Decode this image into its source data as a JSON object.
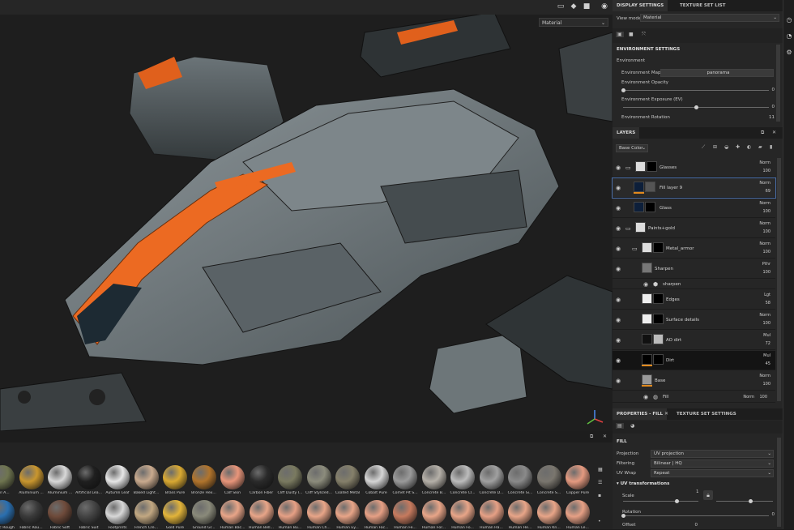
{
  "viewport": {
    "mode": "Material",
    "toolbar_icons": [
      "camera-frame-icon",
      "cube-icon",
      "video-icon",
      "screenshot-icon"
    ]
  },
  "top_tabs": {
    "display_settings": "DISPLAY SETTINGS",
    "texture_set_list": "TEXTURE SET LIST"
  },
  "view_mode": {
    "label": "View mode",
    "value": "Material"
  },
  "environment": {
    "section_title": "ENVIRONMENT SETTINGS",
    "group": "Environment",
    "map_label": "Environment Map",
    "map_value": "panorama",
    "opacity_label": "Environment Opacity",
    "opacity_value": "0",
    "opacity_fraction": 0.0,
    "exposure_label": "Environment Exposure (EV)",
    "exposure_value": "0",
    "exposure_fraction": 0.5,
    "rotation_label": "Environment Rotation",
    "rotation_value": "11"
  },
  "layers": {
    "title": "LAYERS",
    "channel": "Base Color",
    "rows": [
      {
        "name": "Glasses",
        "blend": "Norm",
        "opacity": "100",
        "kind": "folder"
      },
      {
        "name": "Fill layer 9",
        "blend": "Norm",
        "opacity": "69",
        "kind": "fill"
      },
      {
        "name": "Glass",
        "blend": "Norm",
        "opacity": "100",
        "kind": "layer"
      },
      {
        "name": "Paints+gold",
        "blend": "Norm",
        "opacity": "100",
        "kind": "folder"
      },
      {
        "name": "Metal_armor",
        "blend": "Norm",
        "opacity": "100",
        "kind": "folder"
      },
      {
        "name": "Sharpen",
        "blend": "Pthr",
        "opacity": "100",
        "kind": "filter"
      },
      {
        "name": "sharpen",
        "blend": "",
        "opacity": "",
        "kind": "sub"
      },
      {
        "name": "Edges",
        "blend": "Lgt",
        "opacity": "58",
        "kind": "layer"
      },
      {
        "name": "Surface details",
        "blend": "Norm",
        "opacity": "100",
        "kind": "layer"
      },
      {
        "name": "AO dirt",
        "blend": "Mul",
        "opacity": "72",
        "kind": "layer"
      },
      {
        "name": "Dirt",
        "blend": "Mul",
        "opacity": "45",
        "kind": "layer"
      },
      {
        "name": "Base",
        "blend": "Norm",
        "opacity": "100",
        "kind": "layer"
      },
      {
        "name": "Fill",
        "blend": "Norm",
        "opacity": "100",
        "kind": "sub"
      }
    ]
  },
  "properties": {
    "tab_fill": "PROPERTIES - FILL",
    "tab_texture_set": "TEXTURE SET SETTINGS",
    "section": "FILL",
    "projection_label": "Projection",
    "projection_value": "UV projection",
    "filtering_label": "Filtering",
    "filtering_value": "Bilinear | HQ",
    "uvwrap_label": "UV Wrap",
    "uvwrap_value": "Repeat",
    "uv_transform_title": "UV transformations",
    "scale_label": "Scale",
    "scale_value": "1",
    "rotation_label": "Rotation",
    "rotation_value": "0",
    "offset_label": "Offset",
    "offset_value": "0"
  },
  "shelf": {
    "row1": [
      {
        "label": "Soil A...",
        "color": "#6f7550"
      },
      {
        "label": "Aluminium ...",
        "color": "#c9962e"
      },
      {
        "label": "Aluminium ...",
        "color": "#d8d8d8"
      },
      {
        "label": "Artificial Lea...",
        "color": "#1f1f1f"
      },
      {
        "label": "Autumn Leaf",
        "color": "#e7e7e7"
      },
      {
        "label": "Baked Light...",
        "color": "#c9aa8e"
      },
      {
        "label": "Brass Pure",
        "color": "#d9a932"
      },
      {
        "label": "Bronze Hex...",
        "color": "#b1742c"
      },
      {
        "label": "Calf Skin",
        "color": "#e8957a"
      },
      {
        "label": "Carbon Fiber",
        "color": "#2a2a2a"
      },
      {
        "label": "Cliff Dusty I...",
        "color": "#7a7a60"
      },
      {
        "label": "Cliff Stylized...",
        "color": "#8c8c7c"
      },
      {
        "label": "Coated Metal",
        "color": "#85806a"
      },
      {
        "label": "Cobalt Pure",
        "color": "#d5d5d5"
      },
      {
        "label": "Comet Pit S...",
        "color": "#9a9a9a"
      },
      {
        "label": "Concrete B...",
        "color": "#b5b0a8"
      },
      {
        "label": "Concrete Cl...",
        "color": "#bcbcbc"
      },
      {
        "label": "Concrete D...",
        "color": "#a0a0a0"
      },
      {
        "label": "Concrete Si...",
        "color": "#8a8a8a"
      },
      {
        "label": "Concrete S...",
        "color": "#7a766e"
      },
      {
        "label": "Copper Pure",
        "color": "#e59a80"
      }
    ],
    "row2": [
      {
        "label": "Fabric Rough",
        "color": "#2a6fb0"
      },
      {
        "label": "Fabric Rou...",
        "color": "#3a3a3a"
      },
      {
        "label": "Fabric Soft",
        "color": "#6e4a3a"
      },
      {
        "label": "Fabric Suit",
        "color": "#444444"
      },
      {
        "label": "Footprints",
        "color": "#d8d8d8"
      },
      {
        "label": "French Cre...",
        "color": "#c2a882"
      },
      {
        "label": "Gold Pure",
        "color": "#e2b43a"
      },
      {
        "label": "Ground Gr...",
        "color": "#8a8a7a"
      },
      {
        "label": "Human Bac...",
        "color": "#e8a588"
      },
      {
        "label": "Human Bell...",
        "color": "#e8a588"
      },
      {
        "label": "Human Bu...",
        "color": "#e6a085"
      },
      {
        "label": "Human Ch...",
        "color": "#e8a588"
      },
      {
        "label": "Human Ey...",
        "color": "#e8a588"
      },
      {
        "label": "Human Fac...",
        "color": "#e6a085"
      },
      {
        "label": "Human Fe...",
        "color": "#c67a5e"
      },
      {
        "label": "Human For...",
        "color": "#e8a588"
      },
      {
        "label": "Human Fo...",
        "color": "#e8a588"
      },
      {
        "label": "Human Ha...",
        "color": "#e6a085"
      },
      {
        "label": "Human He...",
        "color": "#e8a588"
      },
      {
        "label": "Human Kn...",
        "color": "#e8a588"
      },
      {
        "label": "Human Le...",
        "color": "#e6a085"
      }
    ]
  },
  "colors": {
    "accent_orange": "#e28a1e",
    "selection_blue": "#4a6ea8",
    "panel_bg": "#262626"
  }
}
